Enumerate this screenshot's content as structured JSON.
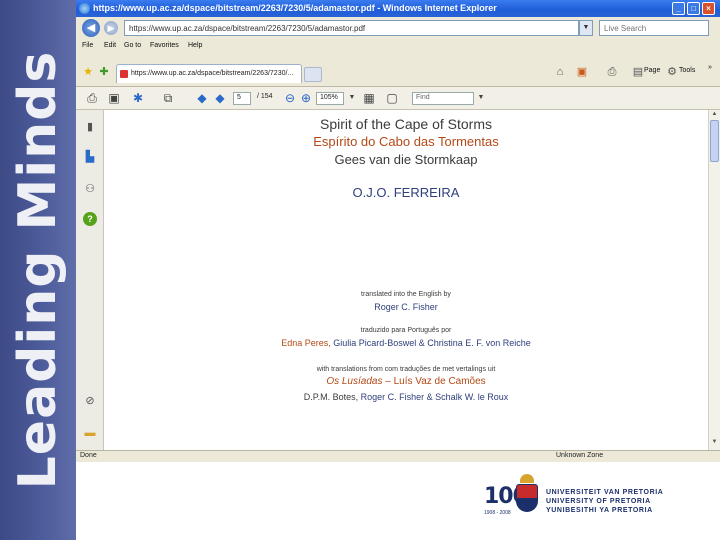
{
  "slide": {
    "side_title": "Leading Minds"
  },
  "window": {
    "title": "https://www.up.ac.za/dspace/bitstream/2263/7230/5/adamastor.pdf - Windows Internet Explorer",
    "address": "https://www.up.ac.za/dspace/bitstream/2263/7230/5/adamastor.pdf",
    "search_placeholder": "Live Search",
    "menu": [
      "File",
      "Edit",
      "Go to",
      "Favorites",
      "Help"
    ],
    "tab_title": "https://www.up.ac.za/dspace/bitstream/2263/7230/...",
    "commands": {
      "page": "Page",
      "tools": "Tools"
    },
    "status_left": "Done",
    "status_zone": "Unknown Zone"
  },
  "pdf_toolbar": {
    "page_current": "5",
    "page_total": "/ 154",
    "zoom": "105%",
    "find_value": "Find"
  },
  "document": {
    "title_en": "Spirit of the Cape of Storms",
    "title_pt": "Espírito do Cabo das Tormentas",
    "title_af": "Gees van die Stormkaap",
    "author": "O.J.O. FERREIRA",
    "translated_en": "translated into the English by",
    "translator_en": "Roger C. Fisher",
    "translated_pt": "traduzido para Português por",
    "translator_pt_1": "Edna Peres,",
    "translator_pt_2": "Giulia Picard-Boswel & Christina E. F. von Reiche",
    "with_translations": "with translations from com traduções de met vertalings uit",
    "lusiadas": "Os Lusíadas",
    "lusiadas_author": "– Luís Vaz de Camões",
    "credit_1": "D.P.M. Botes,",
    "credit_2": "Roger C. Fisher & Schalk W. le Roux"
  },
  "logo": {
    "number": "100",
    "years": "1908 - 2008",
    "line1": "UNIVERSITEIT VAN PRETORIA",
    "line2": "UNIVERSITY OF PRETORIA",
    "line3": "YUNIBESITHI YA PRETORIA"
  },
  "colors": {
    "side_panel": "#4d5c9a",
    "title_bar": "#1f5dd8",
    "doc_orange": "#b34a18",
    "doc_blue": "#2f3f7a",
    "logo_blue": "#1b2f6b",
    "logo_red": "#c82b2b"
  }
}
